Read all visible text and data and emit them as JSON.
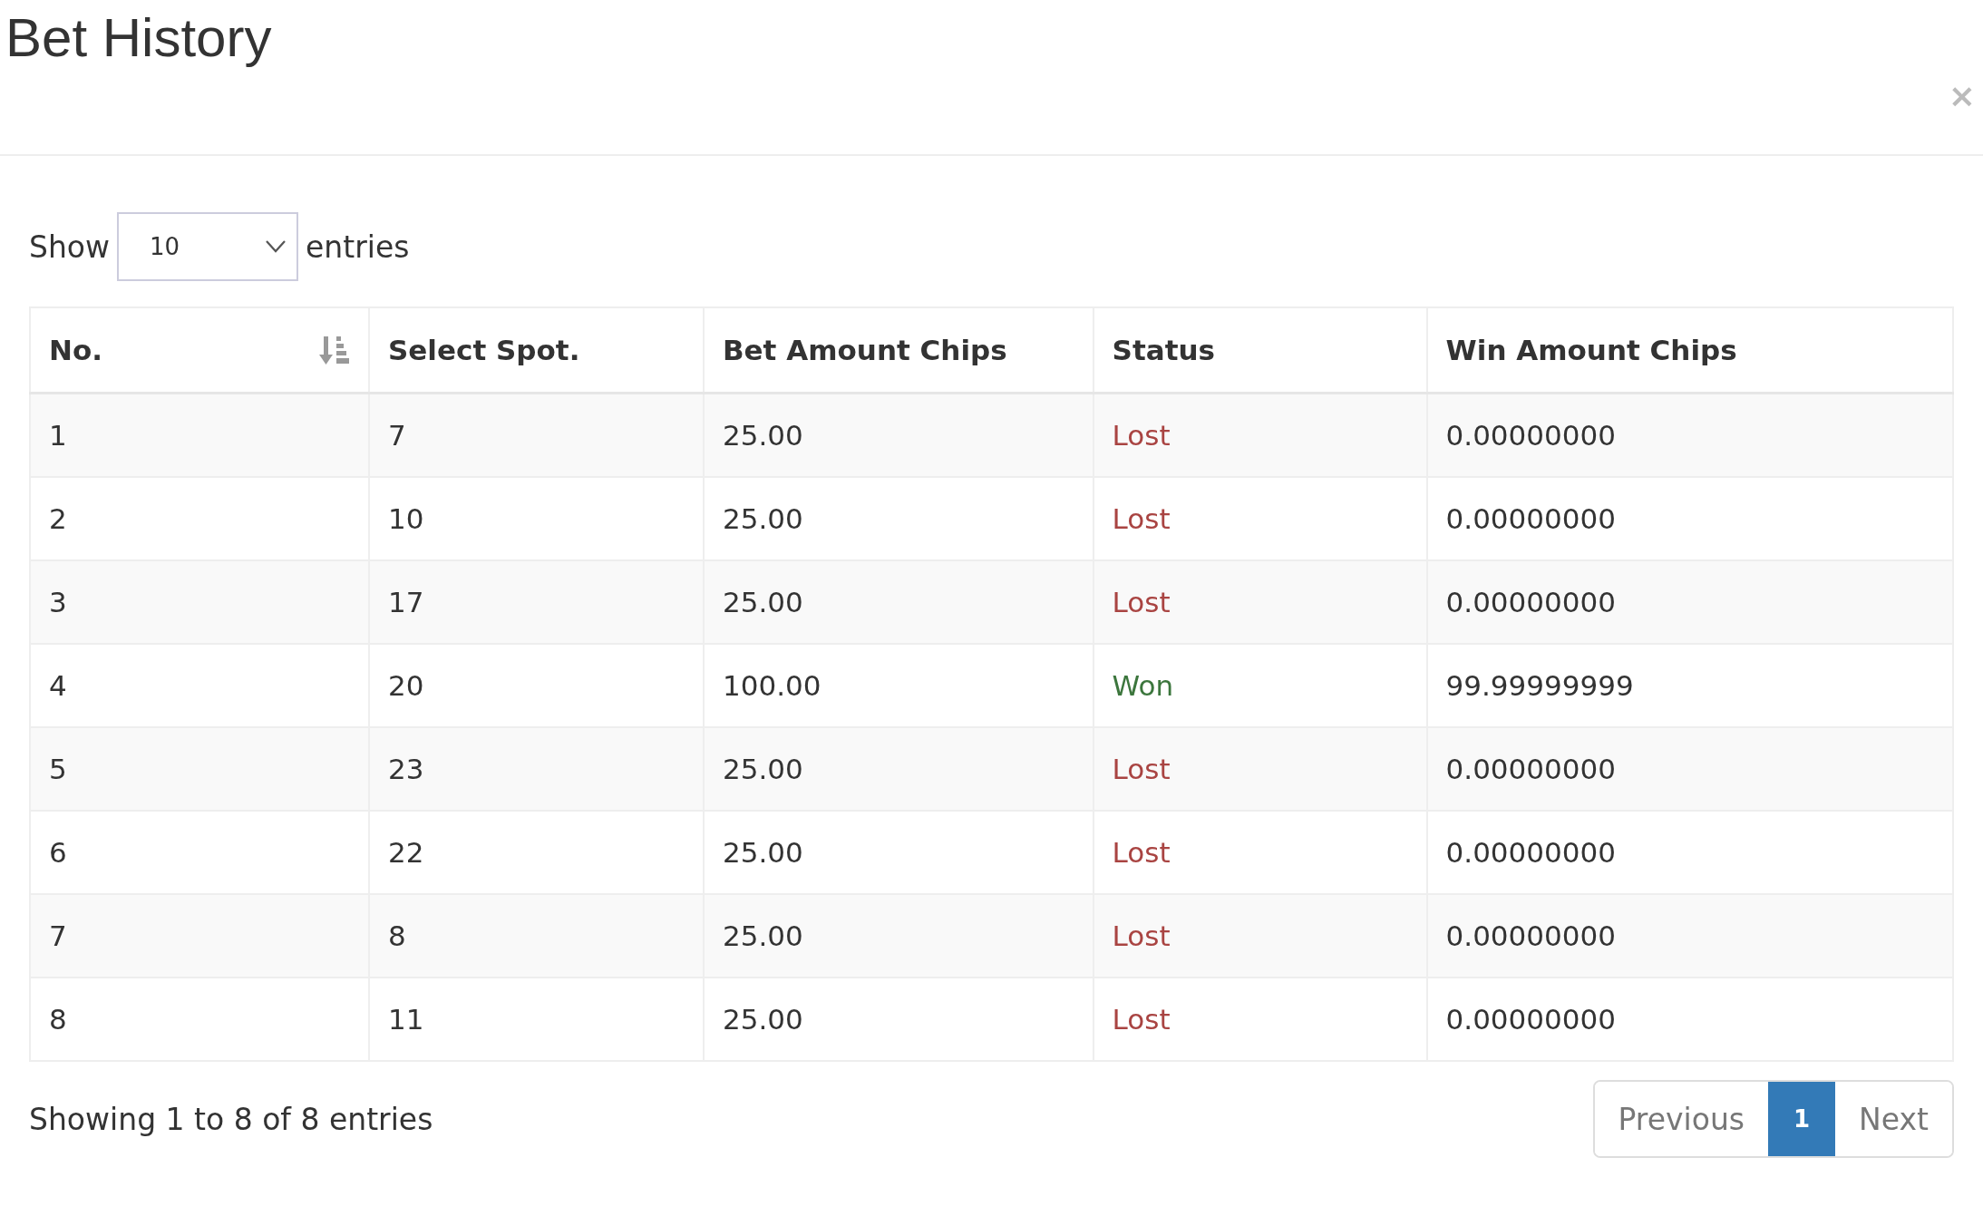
{
  "modal": {
    "title": "Bet History",
    "close": "×"
  },
  "length_menu": {
    "label_before": "Show",
    "value": "10",
    "label_after": "entries"
  },
  "table": {
    "columns": [
      {
        "label": "No.",
        "sorted": true
      },
      {
        "label": "Select Spot.",
        "sorted": false
      },
      {
        "label": "Bet Amount Chips",
        "sorted": false
      },
      {
        "label": "Status",
        "sorted": false
      },
      {
        "label": "Win Amount Chips",
        "sorted": false
      }
    ],
    "rows": [
      {
        "no": "1",
        "spot": "7",
        "bet": "25.00",
        "status": "Lost",
        "color": "#a94442",
        "win": "0.00000000"
      },
      {
        "no": "2",
        "spot": "10",
        "bet": "25.00",
        "status": "Lost",
        "color": "#a94442",
        "win": "0.00000000"
      },
      {
        "no": "3",
        "spot": "17",
        "bet": "25.00",
        "status": "Lost",
        "color": "#a94442",
        "win": "0.00000000"
      },
      {
        "no": "4",
        "spot": "20",
        "bet": "100.00",
        "status": "Won",
        "color": "#3c763d",
        "win": "99.99999999"
      },
      {
        "no": "5",
        "spot": "23",
        "bet": "25.00",
        "status": "Lost",
        "color": "#a94442",
        "win": "0.00000000"
      },
      {
        "no": "6",
        "spot": "22",
        "bet": "25.00",
        "status": "Lost",
        "color": "#a94442",
        "win": "0.00000000"
      },
      {
        "no": "7",
        "spot": "8",
        "bet": "25.00",
        "status": "Lost",
        "color": "#a94442",
        "win": "0.00000000"
      },
      {
        "no": "8",
        "spot": "11",
        "bet": "25.00",
        "status": "Lost",
        "color": "#a94442",
        "win": "0.00000000"
      }
    ]
  },
  "info": "Showing 1 to 8 of 8 entries",
  "pagination": [
    {
      "label": "Previous",
      "selected": false
    },
    {
      "label": "1",
      "selected": true
    },
    {
      "label": "Next",
      "selected": false
    }
  ]
}
